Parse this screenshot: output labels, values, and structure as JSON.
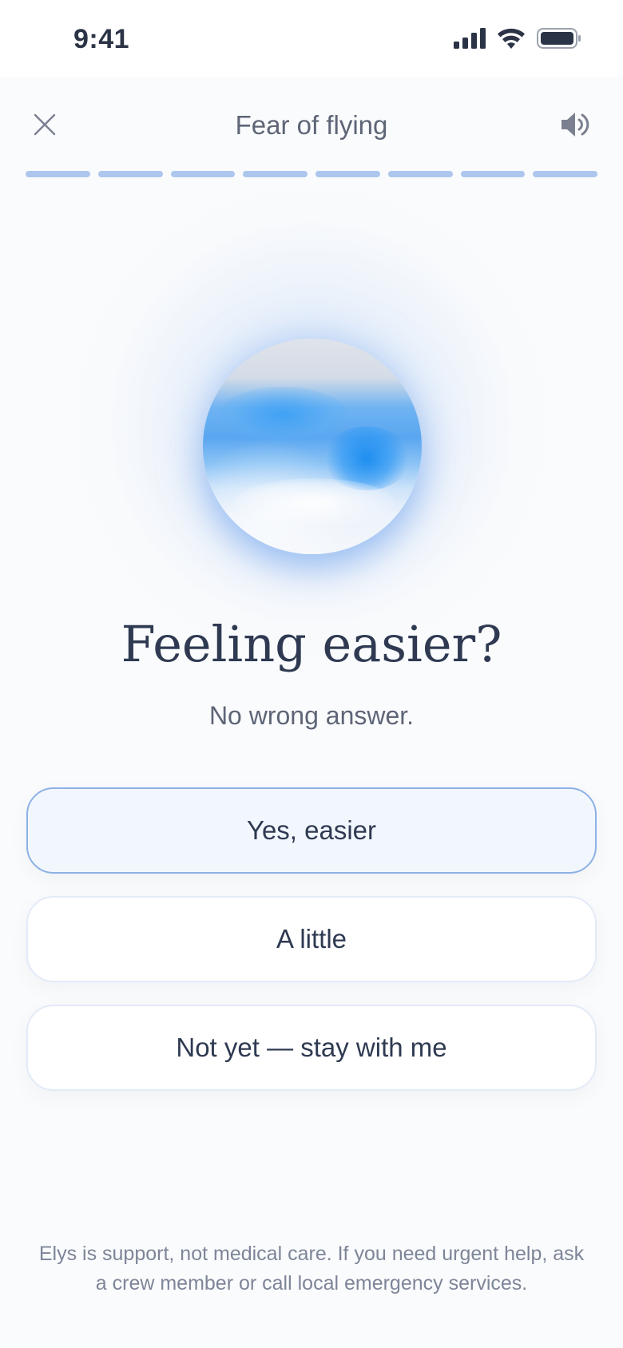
{
  "status_bar": {
    "time": "9:41"
  },
  "header": {
    "title": "Fear of flying"
  },
  "progress": {
    "segments_total": 8,
    "segments_completed": 8
  },
  "question": {
    "title": "Feeling easier?",
    "subtitle": "No wrong answer."
  },
  "options": [
    {
      "label": "Yes, easier",
      "selected": true
    },
    {
      "label": "A little",
      "selected": false
    },
    {
      "label": "Not yet — stay with me",
      "selected": false
    }
  ],
  "footer": {
    "disclaimer": "Elys is support, not medical care. If you need urgent help, ask a crew member or call local emergency services."
  },
  "colors": {
    "accent": "#8db1e6",
    "progress": "#adc6ee",
    "text_primary": "#2f3a52",
    "text_secondary": "#5e6577"
  },
  "icons": {
    "close": "close-icon",
    "sound": "speaker-icon",
    "signal": "cellular-signal-icon",
    "wifi": "wifi-icon",
    "battery": "battery-icon"
  }
}
